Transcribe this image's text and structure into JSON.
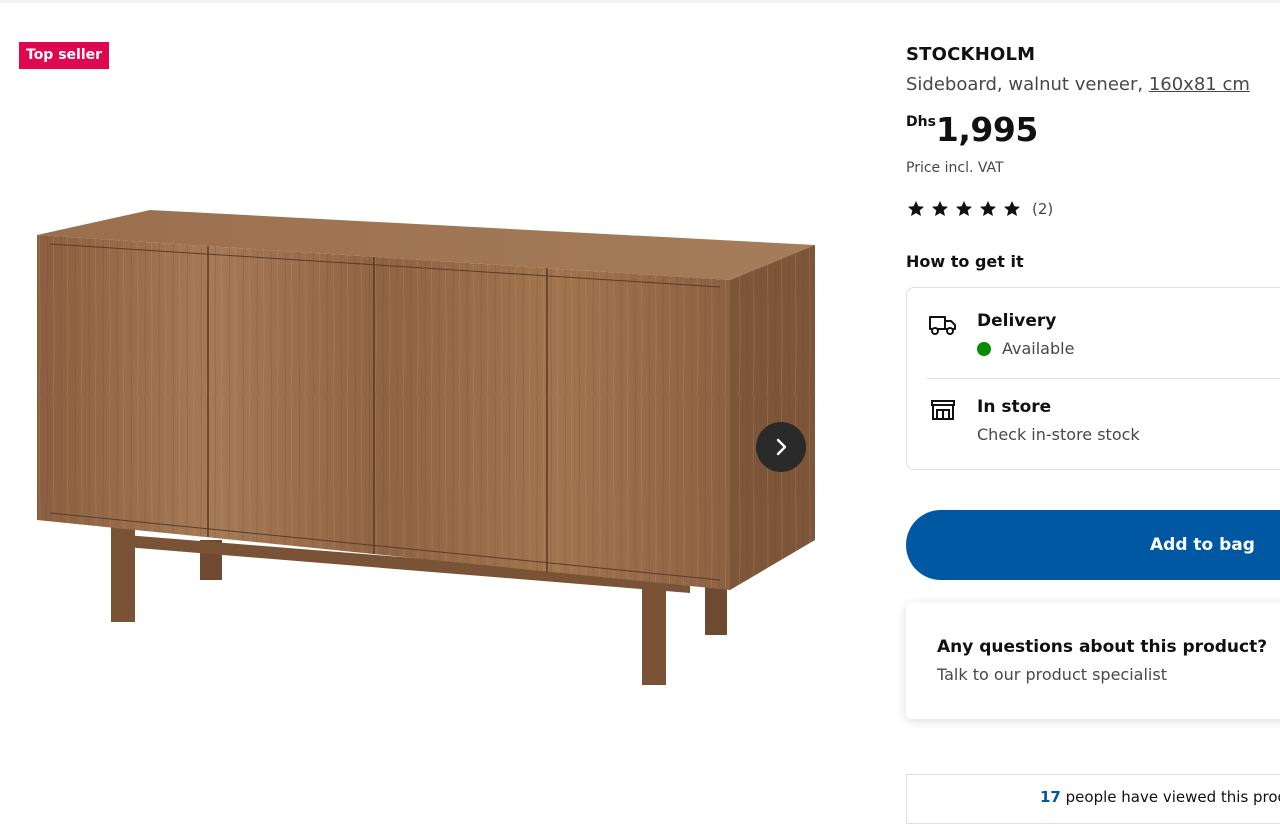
{
  "badge": {
    "label": "Top seller",
    "color": "#e00751"
  },
  "gallery": {
    "next_icon": "chevron-right-icon"
  },
  "product": {
    "name": "STOCKHOLM",
    "description": "Sideboard, walnut veneer, ",
    "dimensions": "160x81 cm",
    "price_currency": "Dhs",
    "price_amount": "1,995",
    "price_note": "Price incl. VAT",
    "rating_stars": 5,
    "rating_count": "(2)"
  },
  "availability": {
    "title": "How to get it",
    "delivery": {
      "icon": "truck-icon",
      "title": "Delivery",
      "status": "Available",
      "status_color": "#0a8a00"
    },
    "store": {
      "icon": "store-icon",
      "title": "In store",
      "subtitle": "Check in-store stock"
    }
  },
  "actions": {
    "add_to_bag": "Add to bag",
    "accent": "#0058a3"
  },
  "questions": {
    "title": "Any questions about this product?",
    "subtitle": "Talk to our product specialist"
  },
  "viewers": {
    "count": "17",
    "text": " people have viewed this prod"
  }
}
